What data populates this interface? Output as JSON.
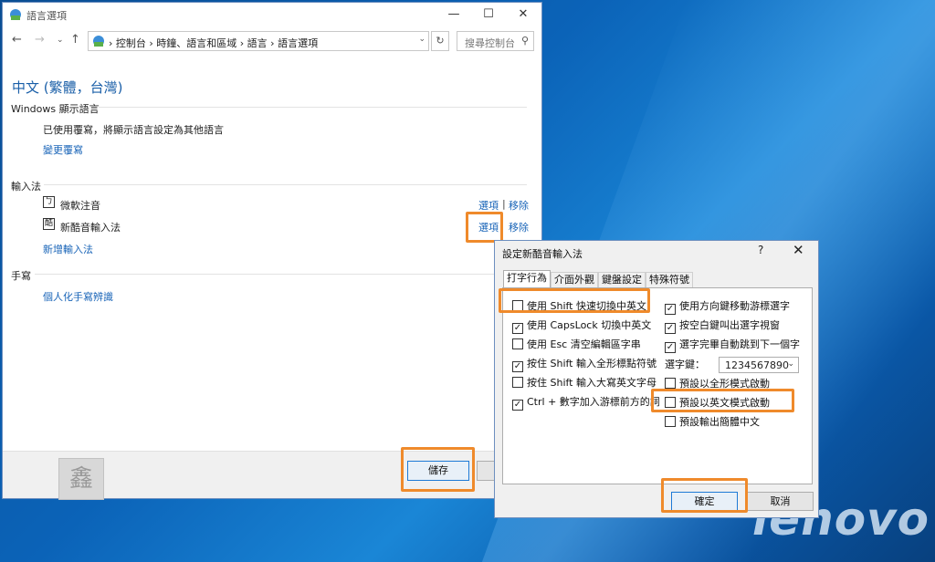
{
  "win": {
    "title": "語言選項",
    "min": "—",
    "max": "☐",
    "close": "✕",
    "nav": {
      "back": "←",
      "forward": "→",
      "dropdown": "⌄",
      "up": "↑"
    },
    "crumbs": "›  控制台  ›  時鐘、語言和區域  ›  語言  ›  語言選項",
    "crumb_dropdown": "⌄",
    "refresh": "↻",
    "search_placeholder": "搜尋控制台",
    "search_icon": "⚲",
    "heading": "中文 (繁體，台灣)",
    "display": {
      "section": "Windows 顯示語言",
      "desc": "已使用覆寫，將顯示語言設定為其他語言",
      "link": "變更覆寫"
    },
    "ime": {
      "section": "輸入法",
      "items": [
        {
          "icon": "ㄅ",
          "name": "微軟注音",
          "opt": "選項",
          "sep": "|",
          "rem": "移除"
        },
        {
          "icon": "酷",
          "name": "新酷音輸入法",
          "opt": "選項",
          "rem": "移除"
        }
      ],
      "add": "新增輸入法"
    },
    "hand": {
      "section": "手寫",
      "link": "個人化手寫辨識"
    },
    "save": "儲存",
    "stamp": "鑫"
  },
  "dlg": {
    "title": "設定新酷音輸入法",
    "help": "?",
    "close": "✕",
    "tabs": [
      "打字行為",
      "介面外觀",
      "鍵盤設定",
      "特殊符號"
    ],
    "left": [
      {
        "label": "使用 Shift 快速切換中英文",
        "checked": false
      },
      {
        "label": "使用 CapsLock 切換中英文",
        "checked": true
      },
      {
        "label": "使用 Esc 清空編輯區字串",
        "checked": false
      },
      {
        "label": "按住 Shift 輸入全形標點符號",
        "checked": true
      },
      {
        "label": "按住 Shift 輸入大寫英文字母",
        "checked": false
      },
      {
        "label": "Ctrl + 數字加入游標前方的詞",
        "checked": true
      }
    ],
    "right": [
      {
        "label": "使用方向鍵移動游標選字",
        "checked": true
      },
      {
        "label": "按空白鍵叫出選字視窗",
        "checked": true
      },
      {
        "label": "選字完畢自動跳到下一個字",
        "checked": true
      },
      {
        "label": "預設以全形模式啟動",
        "checked": false
      },
      {
        "label": "預設以英文模式啟動",
        "checked": false
      },
      {
        "label": "預設輸出簡體中文",
        "checked": false
      }
    ],
    "keys_label": "選字鍵：",
    "keys_value": "1234567890",
    "keys_dropdown": "⌄",
    "ok": "確定",
    "cancel": "取消"
  },
  "desktop": {
    "logo": "lenovo"
  }
}
